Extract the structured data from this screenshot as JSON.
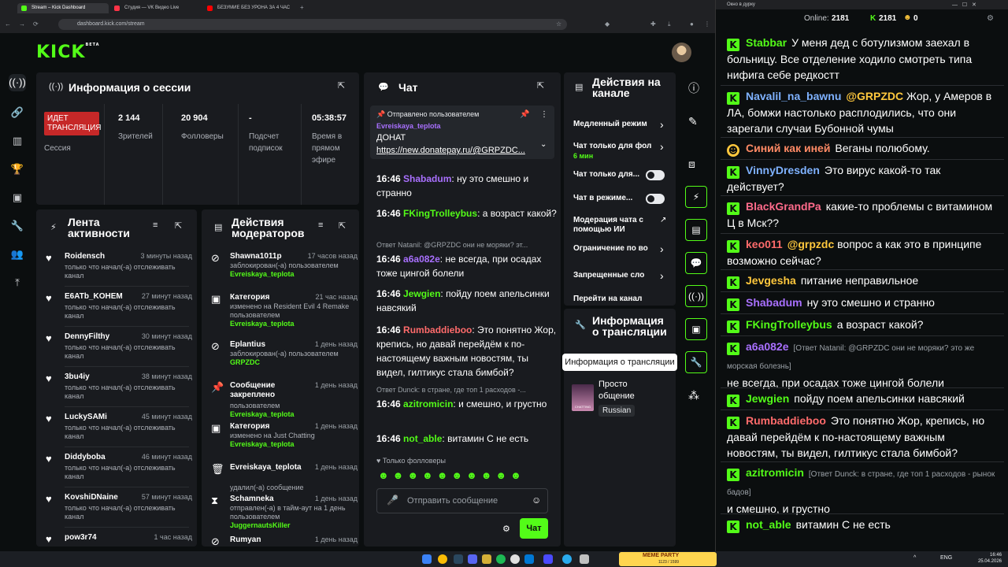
{
  "browser": {
    "tabs": [
      {
        "label": "Stream – Kick Dashboard",
        "color": "#53fc18"
      },
      {
        "label": "Студия — VK Видео Live",
        "color": "#ff3347"
      },
      {
        "label": "БЕЗУМИЕ БЕЗ УРОНА ЗА 4 ЧАС",
        "color": "#ff0000"
      }
    ],
    "new_tab": "+",
    "url": "dashboard.kick.com/stream"
  },
  "app": {
    "logo": "KICK",
    "logo_badge": "BETA",
    "menu_icon": "☰"
  },
  "session": {
    "title": "Информация о сессии",
    "live_badge": "ИДЕТ ТРАНСЛЯЦИЯ",
    "session_label": "Сессия",
    "stats": [
      {
        "value": "2 144",
        "label": "Зрителей"
      },
      {
        "value": "20 904",
        "label": "Фолловеры"
      },
      {
        "value": "-",
        "label": "Подсчет подписок"
      },
      {
        "value": "05:38:57",
        "label": "Время в прямом эфире"
      }
    ]
  },
  "activity": {
    "title": "Лента активности",
    "items": [
      {
        "name": "Roidensch",
        "time": "3 минуты назад",
        "desc": "только что начал(-а) отслеживать канал"
      },
      {
        "name": "E6ATb_KOHEM",
        "time": "27 минут назад",
        "desc": "только что начал(-а) отслеживать канал"
      },
      {
        "name": "DennyFilthy",
        "time": "30 минут назад",
        "desc": "только что начал(-а) отслеживать канал"
      },
      {
        "name": "3bu4iy",
        "time": "38 минут назад",
        "desc": "только что начал(-а) отслеживать канал"
      },
      {
        "name": "LuckySAMi",
        "time": "45 минут назад",
        "desc": "только что начал(-а) отслеживать канал"
      },
      {
        "name": "Diddyboba",
        "time": "46 минут назад",
        "desc": "только что начал(-а) отслеживать канал"
      },
      {
        "name": "KovshiDNaine",
        "time": "57 минут назад",
        "desc": "только что начал(-а) отслеживать канал"
      },
      {
        "name": "pow3r74",
        "time": "1 час назад",
        "desc": ""
      }
    ]
  },
  "mod_actions": {
    "title": "Действия модераторов",
    "items": [
      {
        "name": "Shawna1011p",
        "time": "17 часов назад",
        "desc": "заблокирован(-а) пользователем",
        "extra": "Evreiskaya_teplota"
      },
      {
        "name": "Категория",
        "time": "21 час назад",
        "desc": "изменено на Resident Evil 4 Remake пользователем",
        "extra": "Evreiskaya_teplota"
      },
      {
        "name": "Eplantius",
        "time": "1 день назад",
        "desc": "заблокирован(-а) пользователем",
        "extra": "GRPZDC"
      },
      {
        "name": "Сообщение закреплено",
        "time": "1 день назад",
        "desc": "пользователем",
        "extra": "Evreiskaya_teplota"
      },
      {
        "name": "Категория",
        "time": "1 день назад",
        "desc": "изменено на Just Chatting",
        "extra": "Evreiskaya_teplota"
      },
      {
        "name": "Evreiskaya_teplota",
        "time": "1 день назад",
        "desc": "удалил(-а) сообщение",
        "extra": ""
      },
      {
        "name": "Schamneka",
        "time": "1 день назад",
        "desc": "отправлен(-а) в тайм-аут на 1 день пользователем",
        "extra": "JuggernautsKiller"
      },
      {
        "name": "Rumyan",
        "time": "1 день назад",
        "desc": "",
        "extra": ""
      }
    ]
  },
  "chat": {
    "title": "Чат",
    "pinned_header": "Отправлено пользователем",
    "pinned_user": "Evreiskaya_teplota",
    "pinned_title": "ДОНАТ",
    "pinned_link": "https://new.donatepay.ru/@GRPZDC...",
    "messages": [
      {
        "time": "16:46",
        "user": "Shabadum",
        "color": "#a970ff",
        "text": "ну это смешно и странно",
        "reply": ""
      },
      {
        "time": "16:46",
        "user": "FKingTrolleybus",
        "color": "#53fc18",
        "text": "а возраст какой?",
        "reply": ""
      },
      {
        "time": "16:46",
        "user": "a6a082e",
        "color": "#a970ff",
        "text": "не всегда, при осадах тоже цингой болели",
        "reply": "Ответ Natanil: @GRPZDC они не моряки? эт..."
      },
      {
        "time": "16:46",
        "user": "Jewgien",
        "color": "#53fc18",
        "text": "пойду поем апельсинки навсякий",
        "reply": ""
      },
      {
        "time": "16:46",
        "user": "Rumbaddieboo",
        "color": "#ff6b6b",
        "text": "Это понятно Жор, крепись, но давай перейдём к по-настоящему важным новостям, ты видел, гилтикус стала бимбой?",
        "reply": ""
      },
      {
        "time": "16:46",
        "user": "azitromicin",
        "color": "#53fc18",
        "text": "и смешно, и грустно",
        "reply": "Ответ Dunck: в стране, где топ 1 расходов -..."
      },
      {
        "time": "16:46",
        "user": "not_able",
        "color": "#53fc18",
        "text": "витамин С не есть",
        "reply": ""
      }
    ],
    "followers_only": "Только фолловеры",
    "input_placeholder": "Отправить сообщение",
    "send_label": "Чат"
  },
  "channel_actions": {
    "title": "Действия на канале",
    "items": [
      {
        "label": "Медленный режим",
        "sub": "",
        "control": "chevron"
      },
      {
        "label": "Чат только для фол",
        "sub": "6 мин",
        "control": "chevron"
      },
      {
        "label": "Чат только для...",
        "sub": "",
        "control": "toggle"
      },
      {
        "label": "Чат в режиме...",
        "sub": "",
        "control": "toggle"
      },
      {
        "label": "Модерация чата с помощью ИИ",
        "sub": "",
        "control": "external"
      },
      {
        "label": "Ограничение по во",
        "sub": "",
        "control": "chevron"
      },
      {
        "label": "Запрещенные сло",
        "sub": "",
        "control": "chevron"
      },
      {
        "label": "Перейти на канал",
        "sub": "",
        "control": "none"
      }
    ]
  },
  "stream_info": {
    "title": "Информация о трансляции",
    "tooltip": "Информация о трансляции",
    "category": "Просто общение",
    "language": "Russian",
    "thumb_caption": "CHATTING"
  },
  "popout": {
    "window_title": "Окно в дурку",
    "online_label": "Online:",
    "online_value": "2181",
    "viewers": "2181",
    "coins": "0",
    "messages": [
      {
        "user": "Stabbar",
        "color": "#53fc18",
        "reply": "",
        "text": "У меня дед с ботулизмом заехал в больницу. Все отделение ходило смотреть типа нифига себе редкостт"
      },
      {
        "user": "Navalil_na_bawnu",
        "color": "#7fb2ff",
        "reply": "",
        "mention": "@GRPZDC",
        "text": "Жор, у Амеров в ЛА, бомжи настолько расплодились, что они зарегали случаи Бубонной чумы"
      },
      {
        "user": "Синий как иней",
        "color": "#ff8a65",
        "reply": "",
        "text": "Веганы полюбому."
      },
      {
        "user": "VinnyDresden",
        "color": "#7fb2ff",
        "reply": "",
        "text": "Это вирус какой-то так действует?"
      },
      {
        "user": "BlackGrandPa",
        "color": "#ff6b8b",
        "reply": "",
        "text": "какие-то проблемы с витамином Ц в Мск??"
      },
      {
        "user": "keo011",
        "color": "#ff6b6b",
        "reply": "",
        "mention": "@grpzdc",
        "text": "вопрос а как это в принципе возможно сейчас?"
      },
      {
        "user": "Jevgesha",
        "color": "#ffc83d",
        "reply": "",
        "text": "питание неправильное"
      },
      {
        "user": "Shabadum",
        "color": "#a970ff",
        "reply": "",
        "text": "ну это смешно и странно"
      },
      {
        "user": "FKingTrolleybus",
        "color": "#53fc18",
        "reply": "",
        "text": "а возраст какой?"
      },
      {
        "user": "a6a082e",
        "color": "#a970ff",
        "reply": "[Ответ Natanil: @GRPZDC они не моряки? это же морская болезнь]",
        "text": "не всегда, при осадах тоже цингой болели"
      },
      {
        "user": "Jewgien",
        "color": "#53fc18",
        "reply": "",
        "text": "пойду поем апельсинки навсякий"
      },
      {
        "user": "Rumbaddieboo",
        "color": "#ff6b6b",
        "reply": "",
        "text": "Это понятно Жор, крепись, но давай перейдём к по-настоящему важным новостям, ты видел, гилтикус стала бимбой?"
      },
      {
        "user": "azitromicin",
        "color": "#53fc18",
        "reply": "[Ответ Dunck: в стране, где топ 1 расходов - рынок бадов]",
        "text": "и смешно, и грустно"
      },
      {
        "user": "not_able",
        "color": "#53fc18",
        "reply": "",
        "text": "витамин С не есть"
      }
    ]
  },
  "taskbar": {
    "lang": "ENG",
    "time": "16:46",
    "date": "25.04.2026",
    "widget": "MEME PARTY",
    "widget_sub": "1123 / 1599"
  }
}
